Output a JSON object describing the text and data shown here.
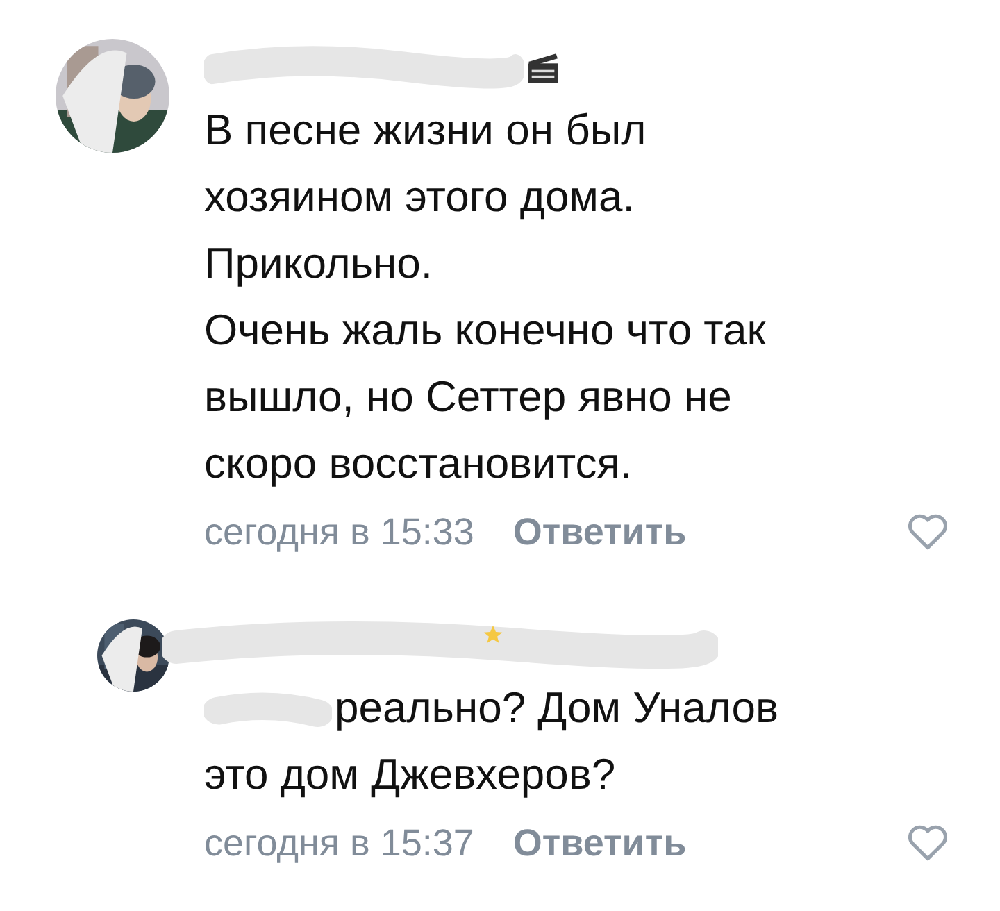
{
  "comments": [
    {
      "kind": "post",
      "mention": false,
      "lines": [
        "В песне жизни он был",
        "хозяином этого дома.",
        "Прикольно.",
        "Очень жаль конечно что так",
        "вышло, но Сеттер явно не",
        "скоро восстановится."
      ],
      "time": "сегодня в 15:33",
      "reply": "Ответить",
      "liked": false
    },
    {
      "kind": "answer",
      "mention": true,
      "lines": [
        "реально? Дом Уналов",
        "это дом Джевхеров?"
      ],
      "time": "сегодня в 15:37",
      "reply": "Ответить",
      "liked": false
    }
  ]
}
